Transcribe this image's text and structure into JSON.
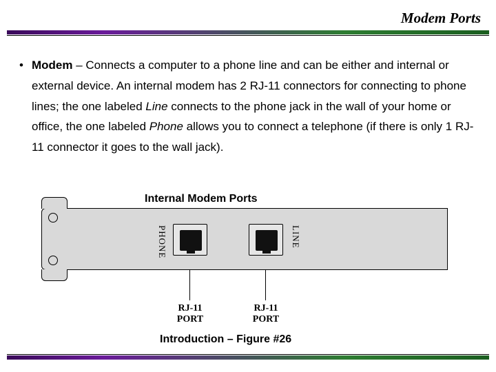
{
  "title": "Modem Ports",
  "bullet": {
    "term": "Modem",
    "sep": " – ",
    "text1": "Connects a computer to a phone line and can be either and internal or external device. An internal modem has 2 RJ-11 connectors for connecting to phone lines; the one labeled ",
    "line_word": "Line",
    "text2": " connects to the phone jack in the wall of your home or office, the one labeled ",
    "phone_word": "Phone",
    "text3": " allows you to connect a telephone (if there is only 1 RJ-11 connector it goes to the wall jack)."
  },
  "figure": {
    "title": "Internal Modem Ports",
    "phone_label": "PHONE",
    "line_label": "LINE",
    "port_label_line1": "RJ-11",
    "port_label_line2": "PORT",
    "caption": "Introduction – Figure #26"
  }
}
